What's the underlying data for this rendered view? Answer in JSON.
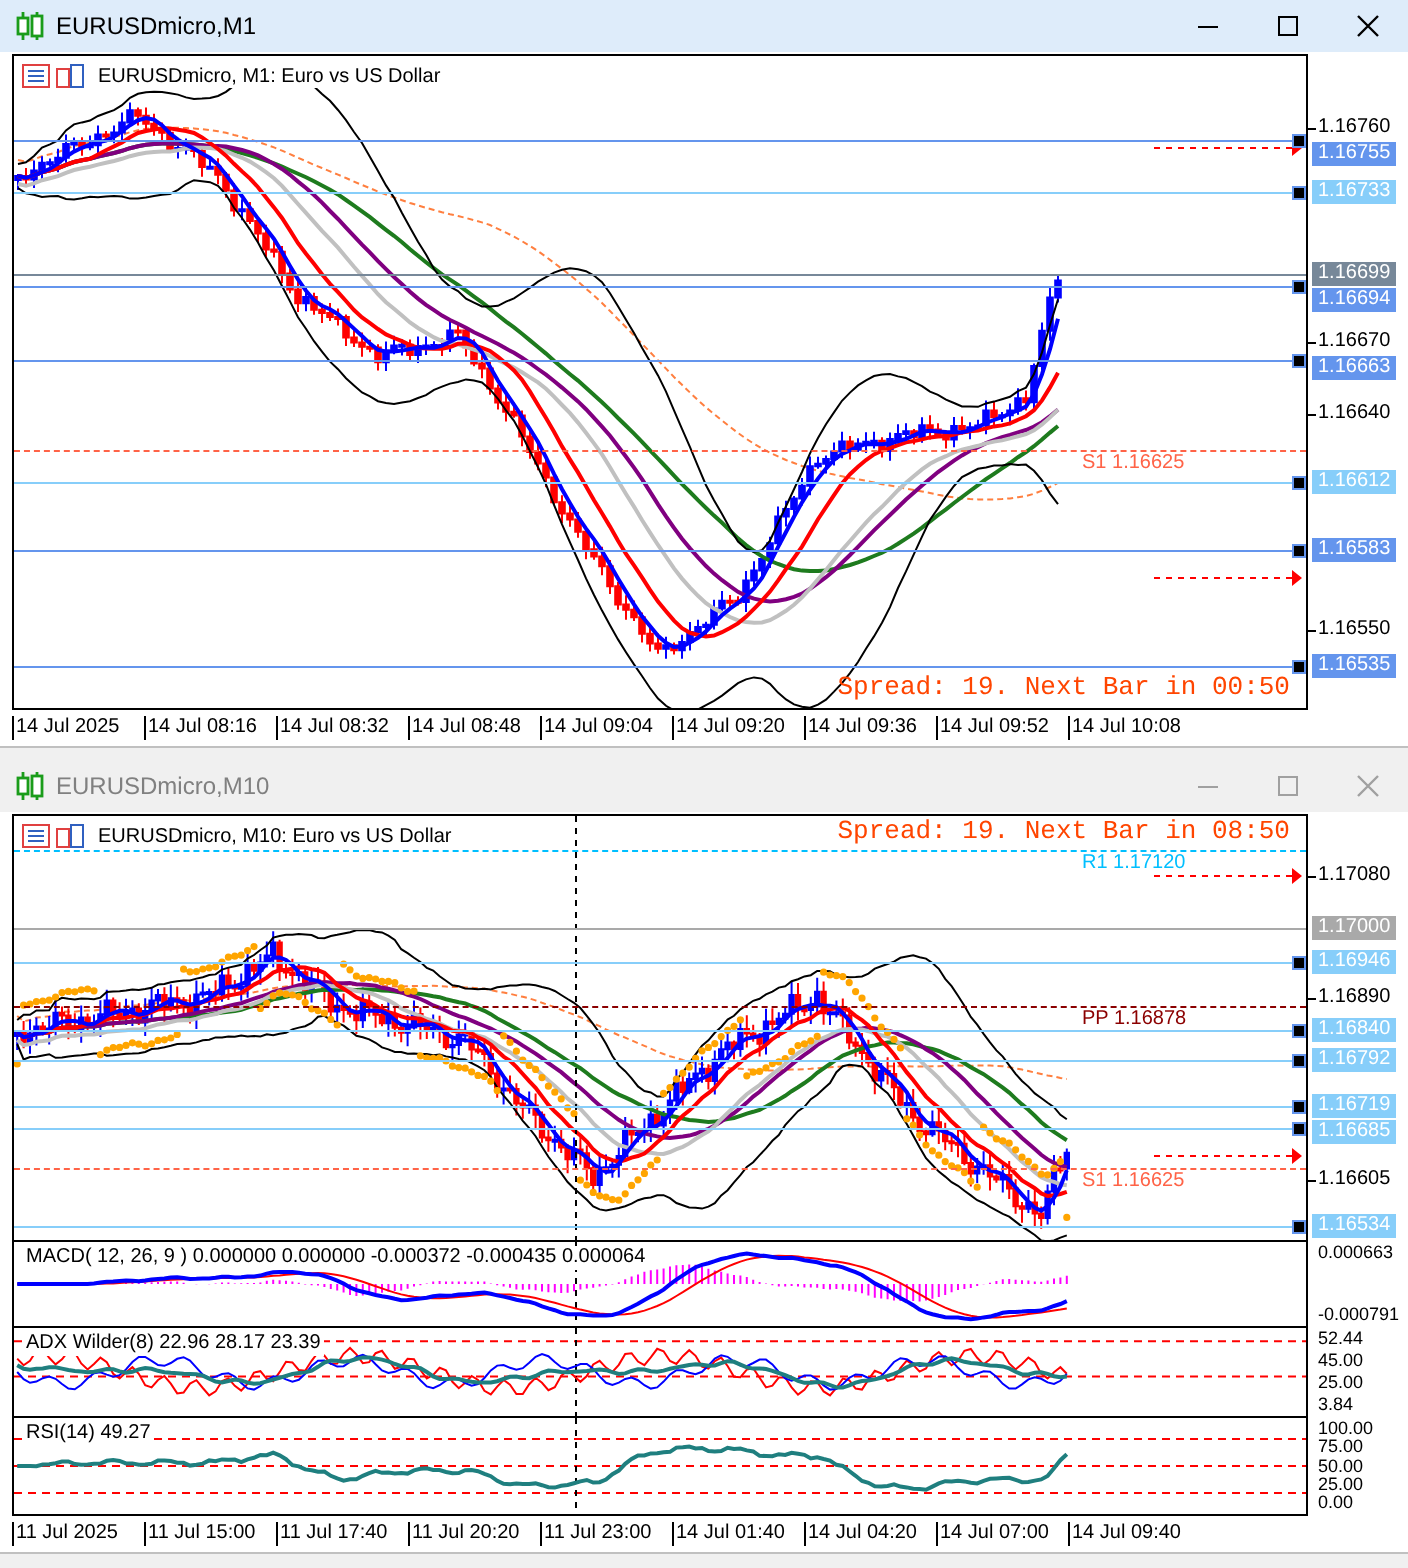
{
  "windows": [
    {
      "title": "EURUSDmicro,M1",
      "active": true,
      "chart_label": "EURUSDmicro, M1:  Euro vs US Dollar",
      "spread": "Spread: 19. Next Bar in 00:50",
      "price_ticks": [
        "1.16760",
        "1.16670",
        "1.16640",
        "1.16550"
      ],
      "price_lines": [
        {
          "label": "1.16755",
          "kind": "level",
          "color": "#6495ed"
        },
        {
          "label": "1.16733",
          "kind": "level",
          "color": "#87cefa"
        },
        {
          "label": "1.16699",
          "kind": "bid",
          "color": "#778899"
        },
        {
          "label": "1.16694",
          "kind": "level",
          "color": "#6495ed"
        },
        {
          "label": "1.16663",
          "kind": "level",
          "color": "#6495ed"
        },
        {
          "label": "1.16612",
          "kind": "level",
          "color": "#87cefa"
        },
        {
          "label": "1.16583",
          "kind": "level",
          "color": "#6495ed"
        },
        {
          "label": "1.16535",
          "kind": "level",
          "color": "#6495ed"
        }
      ],
      "pivots": [
        {
          "label": "S1 1.16625",
          "color": "#ff6347"
        }
      ],
      "time_labels": [
        "14 Jul 2025",
        "14 Jul 08:16",
        "14 Jul 08:32",
        "14 Jul 08:48",
        "14 Jul 09:04",
        "14 Jul 09:20",
        "14 Jul 09:36",
        "14 Jul 09:52",
        "14 Jul 10:08"
      ]
    },
    {
      "title": "EURUSDmicro,M10",
      "active": false,
      "chart_label": "EURUSDmicro, M10:  Euro vs US Dollar",
      "spread": "Spread: 19. Next Bar in 08:50",
      "price_ticks": [
        "1.17080",
        "1.16890",
        "1.16605"
      ],
      "price_lines": [
        {
          "label": "1.17000",
          "kind": "bid",
          "color": "#a9a9a9"
        },
        {
          "label": "1.16946",
          "kind": "level",
          "color": "#87cefa"
        },
        {
          "label": "1.16840",
          "kind": "level",
          "color": "#87cefa"
        },
        {
          "label": "1.16792",
          "kind": "level",
          "color": "#87cefa"
        },
        {
          "label": "1.16719",
          "kind": "level",
          "color": "#87cefa"
        },
        {
          "label": "1.16685",
          "kind": "level",
          "color": "#87cefa"
        },
        {
          "label": "1.16534",
          "kind": "level",
          "color": "#87cefa"
        }
      ],
      "pivots": [
        {
          "label": "R1 1.17120",
          "color": "#00bfff"
        },
        {
          "label": "PP 1.16878",
          "color": "#8b0000"
        },
        {
          "label": "S1 1.16625",
          "color": "#ff6347"
        }
      ],
      "time_labels": [
        "11 Jul 2025",
        "11 Jul 15:00",
        "11 Jul 17:40",
        "11 Jul 20:20",
        "11 Jul 23:00",
        "14 Jul 01:40",
        "14 Jul 04:20",
        "14 Jul 07:00",
        "14 Jul 09:40"
      ],
      "indicators": [
        {
          "kind": "macd",
          "label": "MACD( 12, 26, 9 ) 0.000000 0.000000 -0.000372 -0.000435 0.000064",
          "axis": [
            "0.000663",
            "-0.000791"
          ]
        },
        {
          "kind": "adx",
          "label": "ADX Wilder(8) 22.96 28.17 23.39",
          "axis": [
            "52.44",
            "45.00",
            "25.00",
            "3.84"
          ]
        },
        {
          "kind": "rsi",
          "label": "RSI(14) 49.27",
          "axis": [
            "100.00",
            "75.00",
            "50.00",
            "25.00",
            "0.00"
          ]
        }
      ]
    }
  ]
}
